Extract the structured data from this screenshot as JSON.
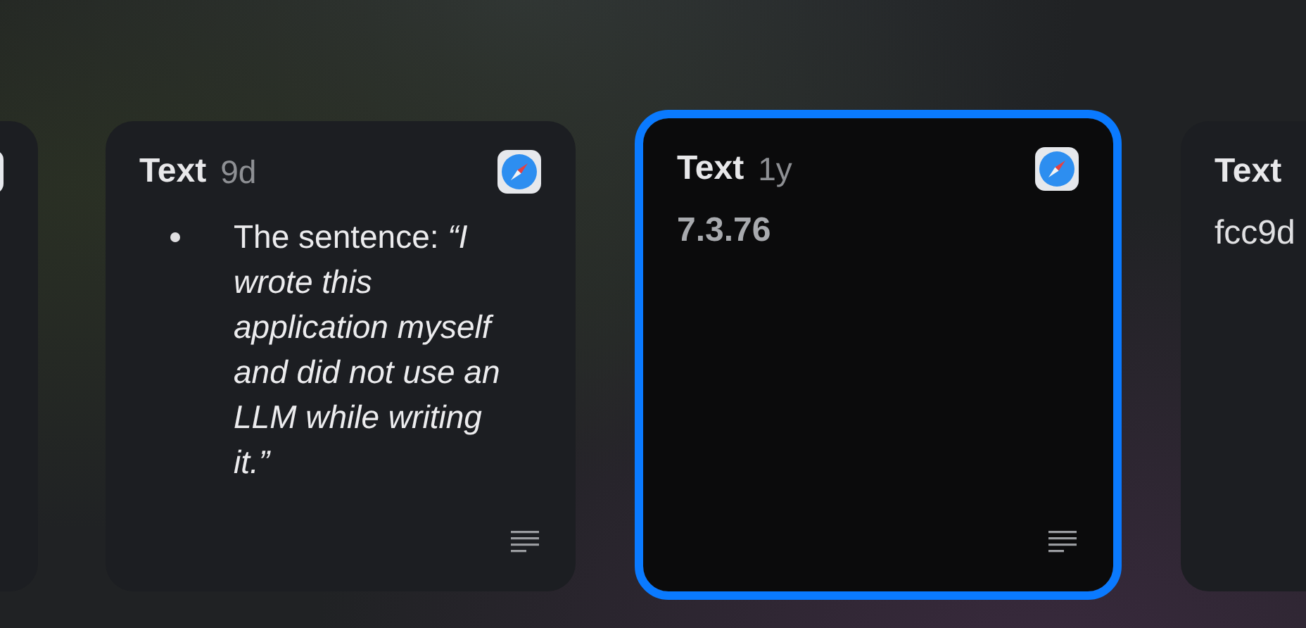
{
  "cards": [
    {
      "selected": false,
      "app_icon": true
    },
    {
      "title": "Text",
      "age": "9d",
      "selected": false,
      "app_icon": true,
      "doc_icon": true,
      "body": {
        "kind": "bullets",
        "items": [
          "The sentence: *“I wrote this application myself and did not use an LLM while writing it.”*"
        ]
      }
    },
    {
      "title": "Text",
      "age": "1y",
      "selected": true,
      "app_icon": true,
      "doc_icon": true,
      "body": {
        "kind": "bold",
        "text": "7.3.76"
      }
    },
    {
      "title": "Text",
      "selected": false,
      "body": {
        "kind": "plain",
        "text": "fcc9d"
      }
    }
  ]
}
